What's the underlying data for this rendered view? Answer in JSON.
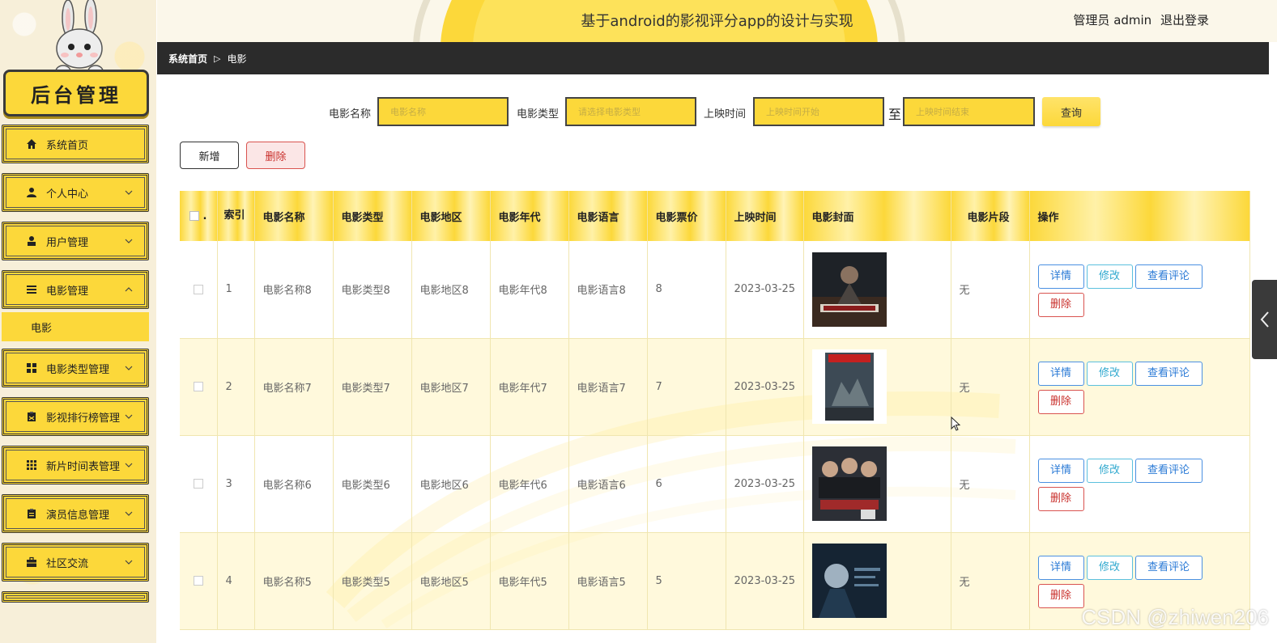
{
  "sidebar": {
    "logo_text": "后台管理",
    "items": [
      {
        "label": "系统首页",
        "icon": "home-icon"
      },
      {
        "label": "个人中心",
        "icon": "user-icon"
      },
      {
        "label": "用户管理",
        "icon": "user-manage-icon"
      },
      {
        "label": "电影管理",
        "icon": "list-icon"
      },
      {
        "label": "电影类型管理",
        "icon": "grid-icon"
      },
      {
        "label": "影视排行榜管理",
        "icon": "clipboard-icon"
      },
      {
        "label": "新片时间表管理",
        "icon": "apps-icon"
      },
      {
        "label": "演员信息管理",
        "icon": "clipboard-icon"
      },
      {
        "label": "社区交流",
        "icon": "briefcase-icon"
      }
    ],
    "submenu": {
      "label": "电影"
    }
  },
  "header": {
    "title": "基于android的影视评分app的设计与实现",
    "user": "管理员 admin",
    "logout": "退出登录"
  },
  "breadcrumb": {
    "home": "系统首页",
    "separator": "▷",
    "current": "电影"
  },
  "search": {
    "name_label": "电影名称",
    "name_placeholder": "电影名称",
    "type_label": "电影类型",
    "type_placeholder": "请选择电影类型",
    "date_label": "上映时间",
    "date_start_placeholder": "上映时间开始",
    "to_label": "至",
    "date_end_placeholder": "上映时间结束",
    "query_button": "查询"
  },
  "actions": {
    "add": "新增",
    "delete": "删除"
  },
  "table": {
    "headers": {
      "index": "索引",
      "name": "电影名称",
      "type": "电影类型",
      "region": "电影地区",
      "year": "电影年代",
      "language": "电影语言",
      "price": "电影票价",
      "release": "上映时间",
      "cover": "电影封面",
      "clip": "电影片段",
      "ops": "操作"
    },
    "rows": [
      {
        "index": "1",
        "name": "电影名称8",
        "type": "电影类型8",
        "region": "电影地区8",
        "year": "电影年代8",
        "language": "电影语言8",
        "price": "8",
        "release": "2023-03-25",
        "clip": "无"
      },
      {
        "index": "2",
        "name": "电影名称7",
        "type": "电影类型7",
        "region": "电影地区7",
        "year": "电影年代7",
        "language": "电影语言7",
        "price": "7",
        "release": "2023-03-25",
        "clip": "无"
      },
      {
        "index": "3",
        "name": "电影名称6",
        "type": "电影类型6",
        "region": "电影地区6",
        "year": "电影年代6",
        "language": "电影语言6",
        "price": "6",
        "release": "2023-03-25",
        "clip": "无"
      },
      {
        "index": "4",
        "name": "电影名称5",
        "type": "电影类型5",
        "region": "电影地区5",
        "year": "电影年代5",
        "language": "电影语言5",
        "price": "5",
        "release": "2023-03-25",
        "clip": "无"
      }
    ],
    "ops": {
      "detail": "详情",
      "edit": "修改",
      "view_comments": "查看评论",
      "delete": "删除"
    }
  },
  "watermark": "CSDN @zhiwen206",
  "colors": {
    "accent": "#fcd83a",
    "dark_bar": "#2b2b2b",
    "danger": "#d9534f",
    "info": "#4a90e2"
  }
}
